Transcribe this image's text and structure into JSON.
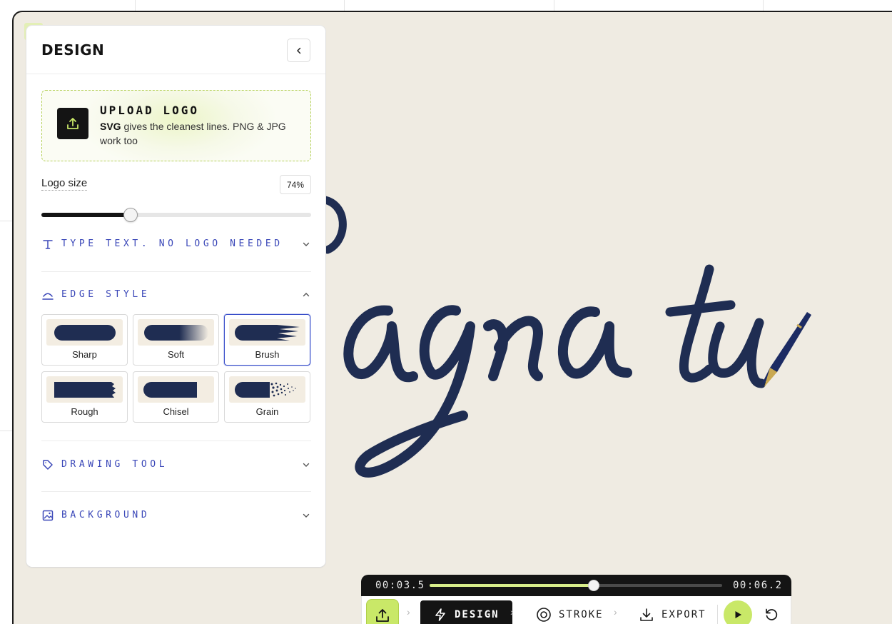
{
  "panel": {
    "title": "DESIGN",
    "upload": {
      "title": "UPLOAD LOGO",
      "desc_bold": "SVG",
      "desc_rest": " gives the cleanest lines. PNG & JPG work too"
    },
    "logo_size": {
      "label": "Logo size",
      "value_text": "74%",
      "slider_fraction": 0.33
    },
    "sections": {
      "type_text": "TYPE TEXT. NO LOGO NEEDED",
      "edge_style": "EDGE STYLE",
      "drawing_tool": "DRAWING TOOL",
      "background": "BACKGROUND"
    },
    "edge_styles": [
      {
        "name": "Sharp",
        "selected": false
      },
      {
        "name": "Soft",
        "selected": false
      },
      {
        "name": "Brush",
        "selected": true
      },
      {
        "name": "Rough",
        "selected": false
      },
      {
        "name": "Chisel",
        "selected": false
      },
      {
        "name": "Grain",
        "selected": false
      }
    ]
  },
  "timeline": {
    "start_time": "00:03.5",
    "end_time": "00:06.2",
    "progress_fraction": 0.56
  },
  "steps": {
    "design": "DESIGN",
    "stroke": "STROKE",
    "export": "EXPORT"
  },
  "colors": {
    "ink": "#1f2d52",
    "accent_blue": "#3a47b8",
    "lime": "#c9e868",
    "canvas_bg": "#efebe2"
  },
  "icons": [
    "collapse-chevron-left-icon",
    "upload-icon",
    "text-t-icon",
    "edge-style-icon",
    "drawing-tool-icon",
    "background-image-icon",
    "bolt-icon",
    "target-icon",
    "download-icon",
    "play-icon",
    "replay-icon",
    "fountain-pen-icon"
  ]
}
